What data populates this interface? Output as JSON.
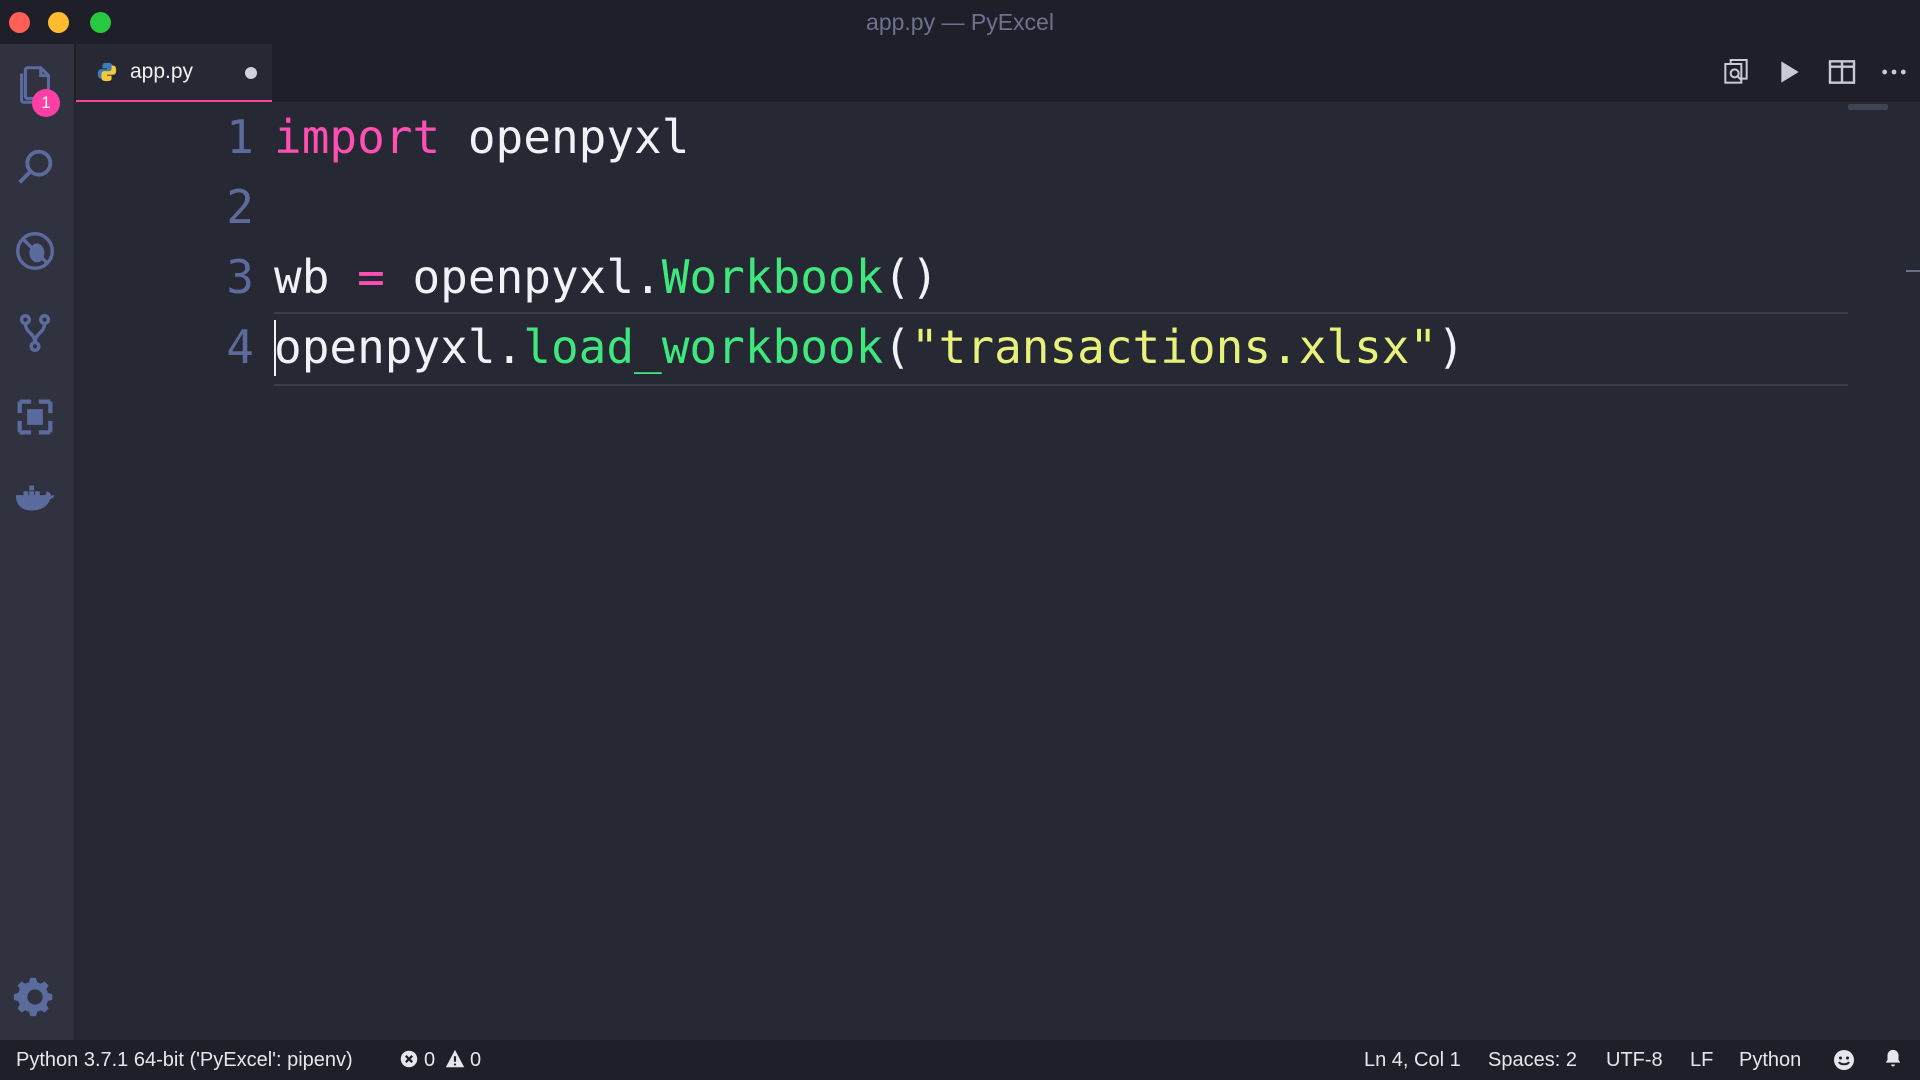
{
  "window": {
    "title": "app.py — PyExcel"
  },
  "activity_bar": {
    "explorer_badge": "1",
    "items": [
      "explorer-icon",
      "search-icon",
      "debug-icon",
      "source-control-icon",
      "extensions-icon",
      "docker-icon",
      "gear-icon"
    ]
  },
  "tabs": [
    {
      "label": "app.py",
      "icon": "python-icon",
      "modified": true
    }
  ],
  "toolbar_actions": [
    "open-preview-icon",
    "run-icon",
    "split-editor-icon",
    "more-actions-icon"
  ],
  "editor": {
    "lines": [
      {
        "number": "1"
      },
      {
        "number": "2"
      },
      {
        "number": "3"
      },
      {
        "number": "4"
      }
    ],
    "tokens": {
      "l1_import": "import",
      "l1_module": " openpyxl",
      "l3_var": "wb",
      "l3_eq": " = ",
      "l3_obj": "openpyxl.",
      "l3_fn": "Workbook",
      "l3_paren": "()",
      "l4_obj": "openpyxl.",
      "l4_fn": "load_workbook",
      "l4_open": "(",
      "l4_str": "\"transactions.xlsx\"",
      "l4_close": ")"
    }
  },
  "status_bar": {
    "interpreter": "Python 3.7.1 64-bit ('PyExcel': pipenv)",
    "errors": "0",
    "warnings": "0",
    "position": "Ln 4, Col 1",
    "spaces": "Spaces: 2",
    "encoding": "UTF-8",
    "eol": "LF",
    "language": "Python"
  },
  "colors": {
    "keyword": "#ff4fb4",
    "function": "#3ee87f",
    "string": "#e8f27a",
    "line_number": "#5c6a9c",
    "accent": "#ff3fa4"
  }
}
